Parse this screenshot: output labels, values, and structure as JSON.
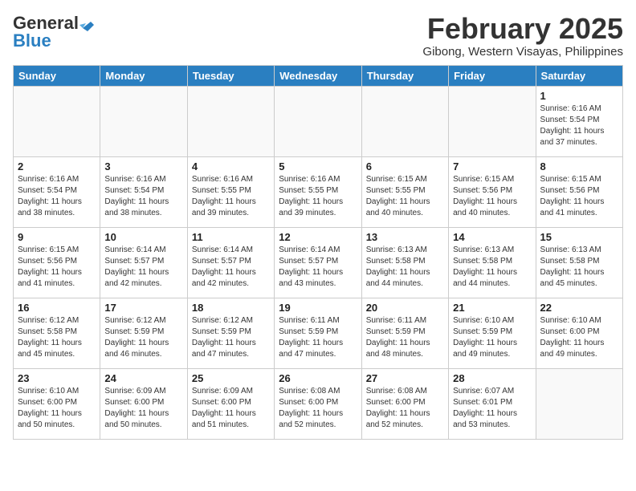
{
  "header": {
    "logo_general": "General",
    "logo_blue": "Blue",
    "month_title": "February 2025",
    "subtitle": "Gibong, Western Visayas, Philippines"
  },
  "weekdays": [
    "Sunday",
    "Monday",
    "Tuesday",
    "Wednesday",
    "Thursday",
    "Friday",
    "Saturday"
  ],
  "weeks": [
    [
      {
        "day": "",
        "info": ""
      },
      {
        "day": "",
        "info": ""
      },
      {
        "day": "",
        "info": ""
      },
      {
        "day": "",
        "info": ""
      },
      {
        "day": "",
        "info": ""
      },
      {
        "day": "",
        "info": ""
      },
      {
        "day": "1",
        "info": "Sunrise: 6:16 AM\nSunset: 5:54 PM\nDaylight: 11 hours and 37 minutes."
      }
    ],
    [
      {
        "day": "2",
        "info": "Sunrise: 6:16 AM\nSunset: 5:54 PM\nDaylight: 11 hours and 38 minutes."
      },
      {
        "day": "3",
        "info": "Sunrise: 6:16 AM\nSunset: 5:54 PM\nDaylight: 11 hours and 38 minutes."
      },
      {
        "day": "4",
        "info": "Sunrise: 6:16 AM\nSunset: 5:55 PM\nDaylight: 11 hours and 39 minutes."
      },
      {
        "day": "5",
        "info": "Sunrise: 6:16 AM\nSunset: 5:55 PM\nDaylight: 11 hours and 39 minutes."
      },
      {
        "day": "6",
        "info": "Sunrise: 6:15 AM\nSunset: 5:55 PM\nDaylight: 11 hours and 40 minutes."
      },
      {
        "day": "7",
        "info": "Sunrise: 6:15 AM\nSunset: 5:56 PM\nDaylight: 11 hours and 40 minutes."
      },
      {
        "day": "8",
        "info": "Sunrise: 6:15 AM\nSunset: 5:56 PM\nDaylight: 11 hours and 41 minutes."
      }
    ],
    [
      {
        "day": "9",
        "info": "Sunrise: 6:15 AM\nSunset: 5:56 PM\nDaylight: 11 hours and 41 minutes."
      },
      {
        "day": "10",
        "info": "Sunrise: 6:14 AM\nSunset: 5:57 PM\nDaylight: 11 hours and 42 minutes."
      },
      {
        "day": "11",
        "info": "Sunrise: 6:14 AM\nSunset: 5:57 PM\nDaylight: 11 hours and 42 minutes."
      },
      {
        "day": "12",
        "info": "Sunrise: 6:14 AM\nSunset: 5:57 PM\nDaylight: 11 hours and 43 minutes."
      },
      {
        "day": "13",
        "info": "Sunrise: 6:13 AM\nSunset: 5:58 PM\nDaylight: 11 hours and 44 minutes."
      },
      {
        "day": "14",
        "info": "Sunrise: 6:13 AM\nSunset: 5:58 PM\nDaylight: 11 hours and 44 minutes."
      },
      {
        "day": "15",
        "info": "Sunrise: 6:13 AM\nSunset: 5:58 PM\nDaylight: 11 hours and 45 minutes."
      }
    ],
    [
      {
        "day": "16",
        "info": "Sunrise: 6:12 AM\nSunset: 5:58 PM\nDaylight: 11 hours and 45 minutes."
      },
      {
        "day": "17",
        "info": "Sunrise: 6:12 AM\nSunset: 5:59 PM\nDaylight: 11 hours and 46 minutes."
      },
      {
        "day": "18",
        "info": "Sunrise: 6:12 AM\nSunset: 5:59 PM\nDaylight: 11 hours and 47 minutes."
      },
      {
        "day": "19",
        "info": "Sunrise: 6:11 AM\nSunset: 5:59 PM\nDaylight: 11 hours and 47 minutes."
      },
      {
        "day": "20",
        "info": "Sunrise: 6:11 AM\nSunset: 5:59 PM\nDaylight: 11 hours and 48 minutes."
      },
      {
        "day": "21",
        "info": "Sunrise: 6:10 AM\nSunset: 5:59 PM\nDaylight: 11 hours and 49 minutes."
      },
      {
        "day": "22",
        "info": "Sunrise: 6:10 AM\nSunset: 6:00 PM\nDaylight: 11 hours and 49 minutes."
      }
    ],
    [
      {
        "day": "23",
        "info": "Sunrise: 6:10 AM\nSunset: 6:00 PM\nDaylight: 11 hours and 50 minutes."
      },
      {
        "day": "24",
        "info": "Sunrise: 6:09 AM\nSunset: 6:00 PM\nDaylight: 11 hours and 50 minutes."
      },
      {
        "day": "25",
        "info": "Sunrise: 6:09 AM\nSunset: 6:00 PM\nDaylight: 11 hours and 51 minutes."
      },
      {
        "day": "26",
        "info": "Sunrise: 6:08 AM\nSunset: 6:00 PM\nDaylight: 11 hours and 52 minutes."
      },
      {
        "day": "27",
        "info": "Sunrise: 6:08 AM\nSunset: 6:00 PM\nDaylight: 11 hours and 52 minutes."
      },
      {
        "day": "28",
        "info": "Sunrise: 6:07 AM\nSunset: 6:01 PM\nDaylight: 11 hours and 53 minutes."
      },
      {
        "day": "",
        "info": ""
      }
    ]
  ]
}
